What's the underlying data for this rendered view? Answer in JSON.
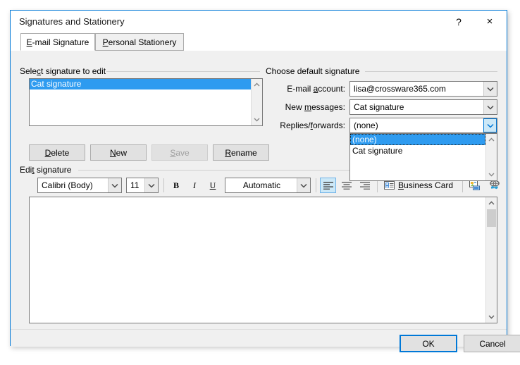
{
  "window": {
    "title": "Signatures and Stationery",
    "help_label": "?",
    "close_label": "×",
    "help_icon": "question-mark-icon",
    "close_icon": "close-icon",
    "border_color": "#0078d7"
  },
  "tabs": [
    {
      "label": "E-mail Signature",
      "accel": "E",
      "active": true
    },
    {
      "label": "Personal Stationery",
      "accel": "P",
      "active": false
    }
  ],
  "select_signature": {
    "group_label_pre": "Sele",
    "group_label_accel": "c",
    "group_label_post": "t signature to edit",
    "group_label_full": "Select signature to edit",
    "items": [
      {
        "label": "Cat signature",
        "selected": true
      }
    ],
    "selection_color": "#2e9bf0",
    "buttons": [
      {
        "label": "Delete",
        "accel": "D",
        "pre": "",
        "post": "elete",
        "enabled": true
      },
      {
        "label": "New",
        "accel": "N",
        "pre": "",
        "post": "ew",
        "enabled": true
      },
      {
        "label": "Save",
        "accel": "S",
        "pre": "",
        "post": "ave",
        "enabled": false
      },
      {
        "label": "Rename",
        "accel": "R",
        "pre": "",
        "post": "ename",
        "enabled": true
      }
    ]
  },
  "choose_default": {
    "group_label": "Choose default signature",
    "fields": [
      {
        "label_pre": "E-mail ",
        "label_accel": "a",
        "label_post": "ccount:",
        "label_full": "E-mail account:",
        "value": "lisa@crossware365.com",
        "open": false
      },
      {
        "label_pre": "New ",
        "label_accel": "m",
        "label_post": "essages:",
        "label_full": "New messages:",
        "value": "Cat signature",
        "open": false
      },
      {
        "label_pre": "Replies/",
        "label_accel": "f",
        "label_post": "orwards:",
        "label_full": "Replies/forwards:",
        "value": "(none)",
        "open": true
      }
    ],
    "dropdown_options": [
      {
        "label": "(none)",
        "selected": true
      },
      {
        "label": "Cat signature",
        "selected": false
      }
    ]
  },
  "edit_signature": {
    "group_label_pre": "Edit",
    "group_label_accel": " ",
    "group_label_post": " signature",
    "group_label_full": "Edit signature",
    "font_family": "Calibri (Body)",
    "font_size": "11",
    "bold_label": "B",
    "italic_label": "I",
    "underline_label": "U",
    "font_color": "Automatic",
    "align_left_icon": "align-left-icon",
    "align_center_icon": "align-center-icon",
    "align_right_icon": "align-right-icon",
    "align_active": "left",
    "business_card_pre": "",
    "business_card_accel": "B",
    "business_card_post": "usiness Card",
    "business_card_label": "Business Card",
    "business_card_icon": "business-card-icon",
    "picture_icon": "insert-picture-icon",
    "hyperlink_icon": "insert-hyperlink-icon",
    "content": "",
    "active_highlight_color": "#cce8f7"
  },
  "footer": {
    "ok_label": "OK",
    "cancel_label": "Cancel"
  }
}
